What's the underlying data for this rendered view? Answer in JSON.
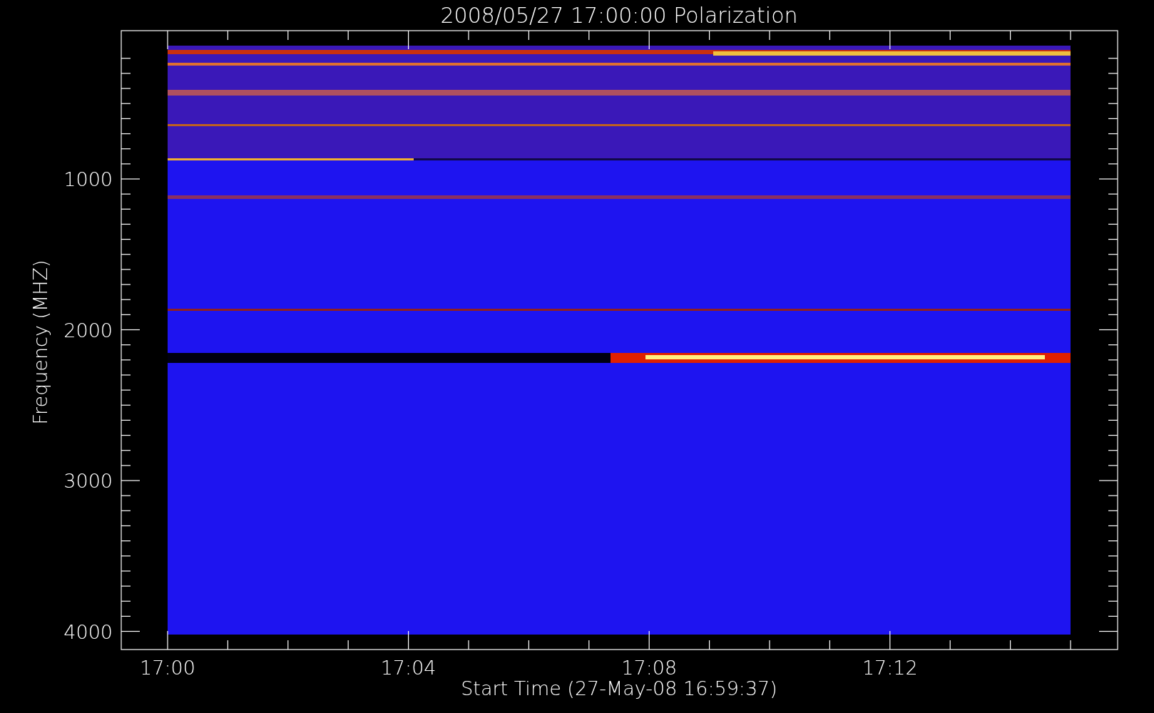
{
  "title": "2008/05/27 17:00:00 Polarization",
  "y_axis": {
    "label": "Frequency (MHZ)",
    "tick_labels": [
      "1000",
      "2000",
      "3000",
      "4000"
    ]
  },
  "x_axis": {
    "label": "Start Time (27-May-08 16:59:37)",
    "tick_labels": [
      "17:00",
      "17:04",
      "17:08",
      "17:12"
    ]
  }
}
